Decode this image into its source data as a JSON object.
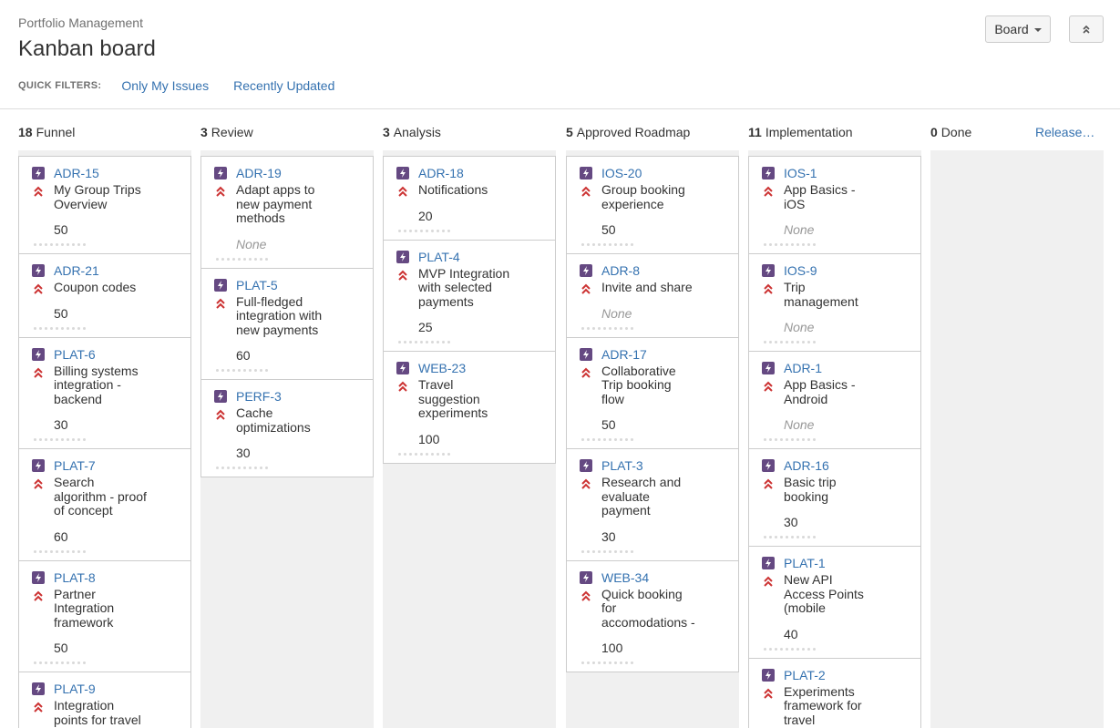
{
  "header": {
    "breadcrumb": "Portfolio Management",
    "title": "Kanban board",
    "board_button_label": "Board"
  },
  "quick_filters": {
    "label": "QUICK FILTERS:",
    "items": [
      "Only My Issues",
      "Recently Updated"
    ]
  },
  "release_label": "Release…",
  "colors": {
    "link": "#3572b0",
    "story_icon": "#654982",
    "priority_highest": "#cc3333",
    "column_bg": "#f0f0f0"
  },
  "icons": {
    "story": "story-lightning-icon",
    "priority": "highest-priority-icon",
    "board_menu": "chevron-down-icon",
    "collapse": "double-chevron-up-icon"
  },
  "columns": [
    {
      "count": "18",
      "name": "Funnel",
      "cards": [
        {
          "key": "ADR-15",
          "summary": [
            "My Group Trips",
            "Overview"
          ],
          "points": "50"
        },
        {
          "key": "ADR-21",
          "summary": [
            "Coupon codes"
          ],
          "points": "50"
        },
        {
          "key": "PLAT-6",
          "summary": [
            "Billing systems",
            "integration -",
            "backend"
          ],
          "points": "30"
        },
        {
          "key": "PLAT-7",
          "summary": [
            "Search",
            "algorithm - proof",
            "of concept"
          ],
          "points": "60"
        },
        {
          "key": "PLAT-8",
          "summary": [
            "Partner",
            "Integration",
            "framework"
          ],
          "points": "50"
        },
        {
          "key": "PLAT-9",
          "summary": [
            "Integration",
            "points for travel"
          ],
          "points": ""
        }
      ]
    },
    {
      "count": "3",
      "name": "Review",
      "cards": [
        {
          "key": "ADR-19",
          "summary": [
            "Adapt apps to",
            "new payment",
            "methods"
          ],
          "points": "None"
        },
        {
          "key": "PLAT-5",
          "summary": [
            "Full-fledged",
            "integration with",
            "new payments"
          ],
          "points": "60"
        },
        {
          "key": "PERF-3",
          "summary": [
            "Cache",
            "optimizations"
          ],
          "points": "30"
        }
      ]
    },
    {
      "count": "3",
      "name": "Analysis",
      "cards": [
        {
          "key": "ADR-18",
          "summary": [
            "Notifications"
          ],
          "points": "20"
        },
        {
          "key": "PLAT-4",
          "summary": [
            "MVP Integration",
            "with selected",
            "payments"
          ],
          "points": "25"
        },
        {
          "key": "WEB-23",
          "summary": [
            "Travel",
            "suggestion",
            "experiments"
          ],
          "points": "100"
        }
      ]
    },
    {
      "count": "5",
      "name": "Approved Roadmap",
      "cards": [
        {
          "key": "IOS-20",
          "summary": [
            "Group booking",
            "experience"
          ],
          "points": "50"
        },
        {
          "key": "ADR-8",
          "summary": [
            "Invite and share"
          ],
          "points": "None"
        },
        {
          "key": "ADR-17",
          "summary": [
            "Collaborative",
            "Trip booking",
            "flow"
          ],
          "points": "50"
        },
        {
          "key": "PLAT-3",
          "summary": [
            "Research and",
            "evaluate",
            "payment"
          ],
          "points": "30"
        },
        {
          "key": "WEB-34",
          "summary": [
            "Quick booking",
            "for",
            "accomodations -"
          ],
          "points": "100"
        }
      ]
    },
    {
      "count": "11",
      "name": "Implementation",
      "cards": [
        {
          "key": "IOS-1",
          "summary": [
            "App Basics -",
            "iOS"
          ],
          "points": "None"
        },
        {
          "key": "IOS-9",
          "summary": [
            "Trip",
            "management"
          ],
          "points": "None"
        },
        {
          "key": "ADR-1",
          "summary": [
            "App Basics -",
            "Android"
          ],
          "points": "None"
        },
        {
          "key": "ADR-16",
          "summary": [
            "Basic trip",
            "booking"
          ],
          "points": "30"
        },
        {
          "key": "PLAT-1",
          "summary": [
            "New API",
            "Access Points",
            "(mobile"
          ],
          "points": "40"
        },
        {
          "key": "PLAT-2",
          "summary": [
            "Experiments",
            "framework for",
            "travel"
          ],
          "points": ""
        }
      ]
    },
    {
      "count": "0",
      "name": "Done",
      "cards": []
    }
  ]
}
